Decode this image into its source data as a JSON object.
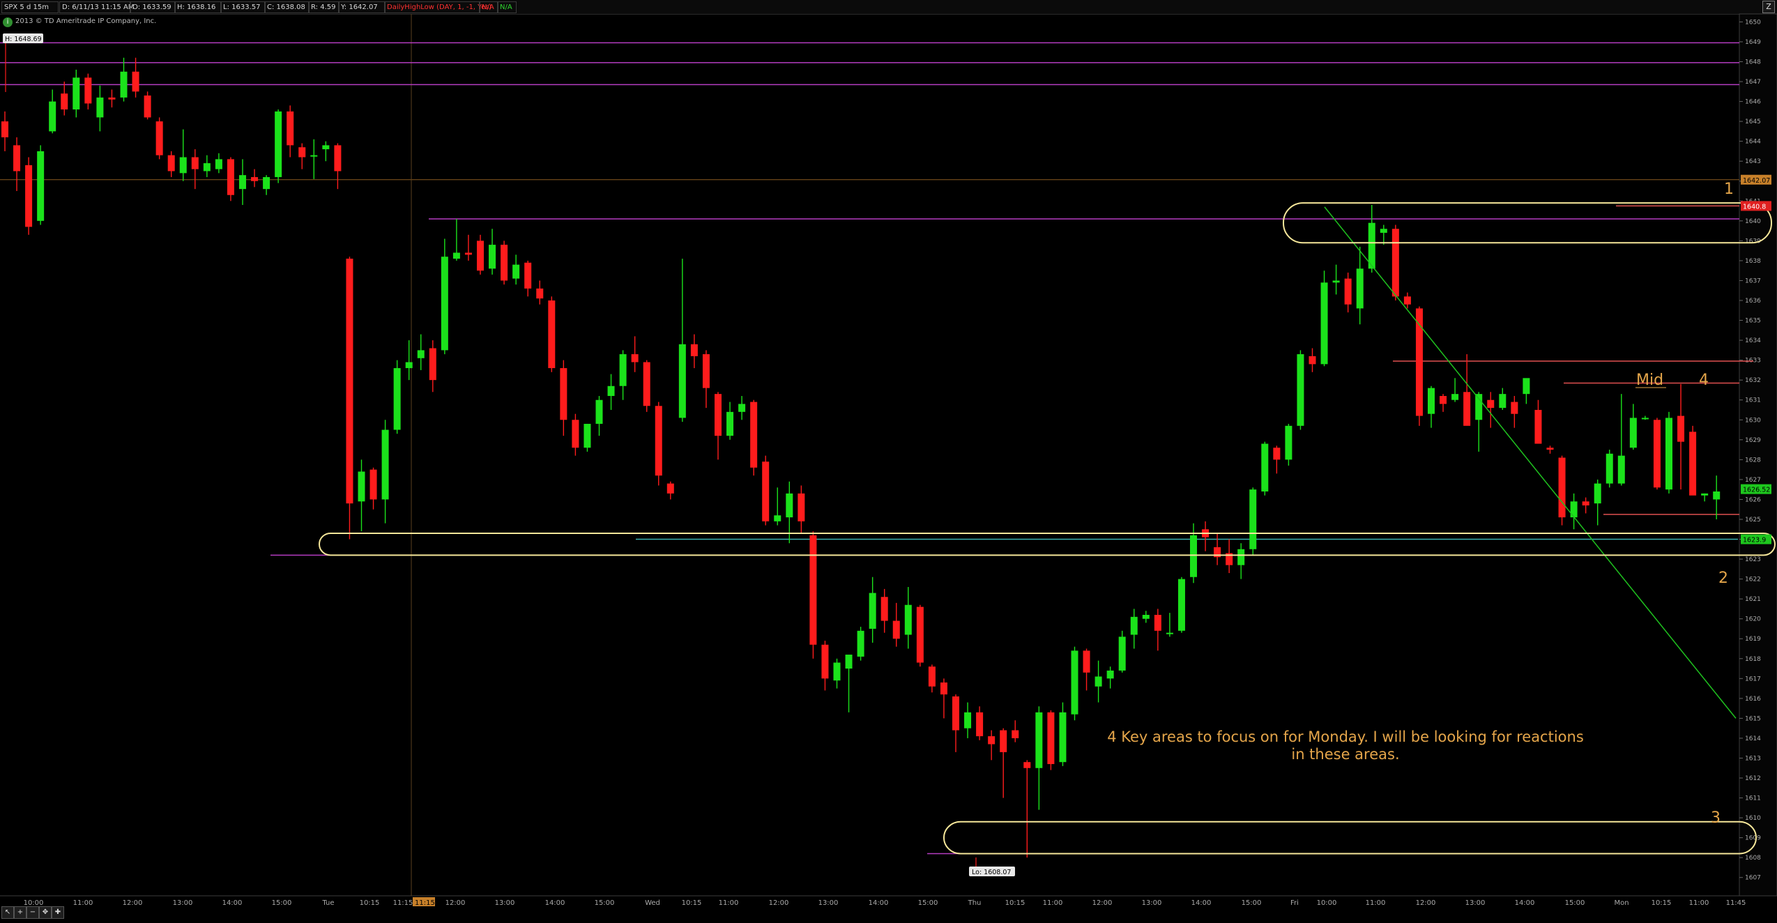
{
  "header": {
    "symbol": "SPX 5 d 15m",
    "datetime": "D: 6/11/13 11:15 AM",
    "open": "O: 1633.59",
    "high": "H: 1638.16",
    "low": "L: 1633.57",
    "close": "C: 1638.08",
    "range": "R: 4.59",
    "y": "Y: 1642.07",
    "study": "DailyHighLow (DAY, 1, -1, Yes)",
    "na1": "N/A",
    "na2": "N/A",
    "copyright": "2013 © TD Ameritrade IP Company, Inc.",
    "ib_icon": "info-i-icon",
    "corner_icon": "z-icon"
  },
  "toolbar": {
    "icons": [
      "arrow-icon",
      "zoom-in-icon",
      "zoom-out-icon",
      "pan-icon",
      "crosshair-icon"
    ]
  },
  "colors": {
    "up": "#1be21b",
    "down": "#ff1c1c",
    "annotation": "#e4a54a",
    "ellipse": "#f6e79a",
    "magenta": "#b43cc0",
    "trend": "#1fc21f",
    "resistance": "#e05050"
  },
  "chart_data": {
    "type": "candlestick",
    "ylim": [
      1606.5,
      1650.4
    ],
    "y_ticks": [
      1607,
      1608,
      1609,
      1610,
      1611,
      1612,
      1613,
      1614,
      1615,
      1616,
      1617,
      1618,
      1619,
      1620,
      1621,
      1622,
      1623,
      1624,
      1625,
      1626,
      1627,
      1628,
      1629,
      1630,
      1631,
      1632,
      1633,
      1634,
      1635,
      1636,
      1637,
      1638,
      1639,
      1640,
      1641,
      1642,
      1643,
      1644,
      1645,
      1646,
      1647,
      1648,
      1649,
      1650
    ],
    "x_ticks": [
      "10:00",
      "11:00",
      "12:00",
      "13:00",
      "14:00",
      "15:00",
      "Tue",
      "10:15",
      "11:15",
      "12:00",
      "13:00",
      "14:00",
      "15:00",
      "Wed",
      "10:15",
      "11:00",
      "12:00",
      "13:00",
      "14:00",
      "15:00",
      "Thu",
      "10:15",
      "11:00",
      "12:00",
      "13:00",
      "14:00",
      "15:00",
      "Fri",
      "10:00",
      "11:00",
      "12:00",
      "13:00",
      "14:00",
      "15:00",
      "Mon",
      "10:15",
      "11:00",
      "11:45"
    ],
    "candles": [
      [
        1645.0,
        1645.5,
        1643.5,
        1644.2
      ],
      [
        1643.8,
        1644.2,
        1641.5,
        1642.5
      ],
      [
        1642.8,
        1643.2,
        1639.3,
        1639.7
      ],
      [
        1640.0,
        1643.8,
        1639.8,
        1643.5
      ],
      [
        1644.5,
        1646.6,
        1644.4,
        1646.0
      ],
      [
        1646.4,
        1647.0,
        1645.3,
        1645.6
      ],
      [
        1645.6,
        1647.6,
        1645.2,
        1647.2
      ],
      [
        1647.2,
        1647.4,
        1645.6,
        1645.9
      ],
      [
        1645.2,
        1646.8,
        1644.5,
        1646.2
      ],
      [
        1646.2,
        1646.6,
        1645.7,
        1646.1
      ],
      [
        1646.2,
        1648.2,
        1646.0,
        1647.5
      ],
      [
        1647.5,
        1648.2,
        1646.2,
        1646.5
      ],
      [
        1646.3,
        1646.5,
        1645.1,
        1645.2
      ],
      [
        1645.0,
        1645.2,
        1643.1,
        1643.3
      ],
      [
        1643.3,
        1643.5,
        1642.2,
        1642.5
      ],
      [
        1642.4,
        1644.6,
        1642.0,
        1643.2
      ],
      [
        1643.2,
        1643.6,
        1641.6,
        1642.6
      ],
      [
        1642.5,
        1643.3,
        1642.2,
        1642.9
      ],
      [
        1642.6,
        1643.4,
        1642.4,
        1643.1
      ],
      [
        1643.1,
        1643.2,
        1641.0,
        1641.3
      ],
      [
        1641.6,
        1643.1,
        1640.8,
        1642.3
      ],
      [
        1642.2,
        1642.6,
        1641.7,
        1642.0
      ],
      [
        1641.6,
        1642.3,
        1641.3,
        1642.2
      ],
      [
        1642.2,
        1645.6,
        1641.9,
        1645.5
      ],
      [
        1645.5,
        1645.8,
        1643.2,
        1643.8
      ],
      [
        1643.7,
        1643.9,
        1642.6,
        1643.2
      ],
      [
        1643.3,
        1644.1,
        1642.1,
        1643.3
      ],
      [
        1643.6,
        1644.0,
        1643.0,
        1643.8
      ],
      [
        1643.8,
        1643.9,
        1641.6,
        1642.5
      ],
      [
        1638.1,
        1638.2,
        1624.0,
        1625.8
      ],
      [
        1625.9,
        1628.0,
        1624.4,
        1627.4
      ],
      [
        1627.5,
        1627.6,
        1625.5,
        1626.0
      ],
      [
        1626.0,
        1630.0,
        1624.8,
        1629.5
      ],
      [
        1629.5,
        1633.0,
        1629.3,
        1632.6
      ],
      [
        1632.6,
        1634.0,
        1632.0,
        1632.9
      ],
      [
        1633.1,
        1634.3,
        1632.5,
        1633.5
      ],
      [
        1633.6,
        1634.0,
        1631.4,
        1632.0
      ],
      [
        1633.5,
        1639.1,
        1633.3,
        1638.2
      ],
      [
        1638.1,
        1640.1,
        1638.0,
        1638.4
      ],
      [
        1638.4,
        1639.3,
        1638.0,
        1638.3
      ],
      [
        1639.0,
        1639.3,
        1637.3,
        1637.5
      ],
      [
        1637.6,
        1639.6,
        1637.3,
        1638.8
      ],
      [
        1638.8,
        1639.0,
        1636.8,
        1637.0
      ],
      [
        1637.1,
        1638.3,
        1636.8,
        1637.8
      ],
      [
        1637.9,
        1638.0,
        1636.2,
        1636.6
      ],
      [
        1636.6,
        1637.0,
        1635.8,
        1636.1
      ],
      [
        1636.0,
        1636.2,
        1632.4,
        1632.6
      ],
      [
        1632.6,
        1633.0,
        1629.2,
        1630.0
      ],
      [
        1630.0,
        1630.3,
        1628.2,
        1628.6
      ],
      [
        1628.6,
        1629.8,
        1628.4,
        1629.8
      ],
      [
        1629.8,
        1631.2,
        1629.2,
        1631.0
      ],
      [
        1631.2,
        1632.3,
        1630.5,
        1631.7
      ],
      [
        1631.7,
        1633.5,
        1631.0,
        1633.3
      ],
      [
        1633.3,
        1634.2,
        1632.4,
        1632.9
      ],
      [
        1632.9,
        1633.0,
        1630.4,
        1630.7
      ],
      [
        1630.7,
        1630.9,
        1626.7,
        1627.2
      ],
      [
        1626.8,
        1626.9,
        1626.0,
        1626.3
      ],
      [
        1630.1,
        1638.1,
        1629.9,
        1633.8
      ],
      [
        1633.8,
        1634.3,
        1632.6,
        1633.2
      ],
      [
        1633.3,
        1633.5,
        1630.6,
        1631.6
      ],
      [
        1631.3,
        1631.4,
        1628.0,
        1629.2
      ],
      [
        1629.2,
        1630.9,
        1629.0,
        1630.4
      ],
      [
        1630.4,
        1631.2,
        1630.0,
        1630.8
      ],
      [
        1630.9,
        1631.0,
        1627.2,
        1627.6
      ],
      [
        1627.9,
        1628.2,
        1624.7,
        1624.9
      ],
      [
        1624.9,
        1626.6,
        1624.7,
        1625.2
      ],
      [
        1625.1,
        1626.9,
        1623.8,
        1626.3
      ],
      [
        1626.3,
        1626.7,
        1624.3,
        1624.9
      ],
      [
        1624.2,
        1624.4,
        1618.0,
        1618.7
      ],
      [
        1618.7,
        1618.9,
        1616.4,
        1617.0
      ],
      [
        1616.9,
        1618.0,
        1616.5,
        1617.8
      ],
      [
        1617.5,
        1618.0,
        1615.3,
        1618.2
      ],
      [
        1618.1,
        1619.6,
        1617.9,
        1619.4
      ],
      [
        1619.5,
        1622.1,
        1618.8,
        1621.3
      ],
      [
        1621.1,
        1621.5,
        1619.3,
        1619.9
      ],
      [
        1619.9,
        1620.8,
        1618.6,
        1619.0
      ],
      [
        1619.2,
        1621.6,
        1618.5,
        1620.7
      ],
      [
        1620.6,
        1620.7,
        1617.6,
        1617.8
      ],
      [
        1617.6,
        1617.7,
        1616.3,
        1616.6
      ],
      [
        1616.8,
        1617.0,
        1615.0,
        1616.2
      ],
      [
        1616.1,
        1616.2,
        1613.3,
        1614.4
      ],
      [
        1614.5,
        1615.8,
        1614.0,
        1615.3
      ],
      [
        1615.3,
        1615.6,
        1613.9,
        1614.1
      ],
      [
        1614.1,
        1614.4,
        1612.9,
        1613.7
      ],
      [
        1614.4,
        1614.5,
        1611.0,
        1613.3
      ],
      [
        1614.4,
        1614.9,
        1613.8,
        1614.0
      ],
      [
        1612.8,
        1612.9,
        1608.0,
        1612.5
      ],
      [
        1612.5,
        1615.6,
        1610.4,
        1615.3
      ],
      [
        1615.3,
        1615.4,
        1612.4,
        1612.7
      ],
      [
        1612.8,
        1615.8,
        1612.6,
        1615.3
      ],
      [
        1615.2,
        1618.6,
        1614.9,
        1618.4
      ],
      [
        1618.4,
        1618.5,
        1616.4,
        1617.3
      ],
      [
        1616.6,
        1617.9,
        1615.8,
        1617.1
      ],
      [
        1617.0,
        1617.6,
        1616.5,
        1617.4
      ],
      [
        1617.4,
        1619.4,
        1617.3,
        1619.1
      ],
      [
        1619.2,
        1620.5,
        1618.5,
        1620.1
      ],
      [
        1620.0,
        1620.4,
        1619.8,
        1620.2
      ],
      [
        1620.2,
        1620.5,
        1618.4,
        1619.4
      ],
      [
        1619.3,
        1620.3,
        1619.1,
        1619.3
      ],
      [
        1619.4,
        1622.1,
        1619.3,
        1622.0
      ],
      [
        1622.1,
        1624.8,
        1621.8,
        1624.2
      ],
      [
        1624.5,
        1624.9,
        1623.4,
        1624.1
      ],
      [
        1623.6,
        1624.3,
        1622.7,
        1623.1
      ],
      [
        1623.3,
        1624.0,
        1622.3,
        1622.7
      ],
      [
        1622.7,
        1623.8,
        1622.0,
        1623.5
      ],
      [
        1623.5,
        1626.6,
        1623.2,
        1626.5
      ],
      [
        1626.4,
        1628.9,
        1626.2,
        1628.8
      ],
      [
        1628.6,
        1628.7,
        1627.3,
        1628.0
      ],
      [
        1628.0,
        1629.8,
        1627.7,
        1629.7
      ],
      [
        1629.7,
        1633.5,
        1629.5,
        1633.3
      ],
      [
        1633.2,
        1633.6,
        1632.4,
        1632.8
      ],
      [
        1632.8,
        1637.5,
        1632.7,
        1636.9
      ],
      [
        1636.9,
        1637.8,
        1636.3,
        1637.0
      ],
      [
        1637.1,
        1637.4,
        1635.4,
        1635.8
      ],
      [
        1635.6,
        1638.7,
        1634.8,
        1637.6
      ],
      [
        1637.6,
        1640.8,
        1637.4,
        1639.9
      ],
      [
        1639.4,
        1639.8,
        1638.8,
        1639.6
      ],
      [
        1639.6,
        1639.8,
        1636.0,
        1636.2
      ],
      [
        1636.2,
        1636.4,
        1635.6,
        1635.8
      ],
      [
        1635.6,
        1635.7,
        1629.7,
        1630.2
      ],
      [
        1630.3,
        1631.7,
        1629.6,
        1631.6
      ],
      [
        1631.2,
        1631.3,
        1630.4,
        1630.8
      ],
      [
        1631.0,
        1632.1,
        1630.9,
        1631.3
      ],
      [
        1631.4,
        1633.3,
        1630.3,
        1629.7
      ],
      [
        1630.0,
        1631.4,
        1628.4,
        1631.3
      ],
      [
        1631.0,
        1631.4,
        1629.6,
        1630.6
      ],
      [
        1630.6,
        1631.6,
        1630.5,
        1631.3
      ],
      [
        1630.9,
        1631.2,
        1629.6,
        1630.3
      ],
      [
        1631.3,
        1631.9,
        1630.8,
        1632.1
      ],
      [
        1630.5,
        1631.0,
        1628.8,
        1628.8
      ],
      [
        1628.6,
        1628.7,
        1628.3,
        1628.5
      ],
      [
        1628.1,
        1628.2,
        1624.7,
        1625.1
      ],
      [
        1625.1,
        1626.3,
        1624.5,
        1625.9
      ],
      [
        1625.9,
        1626.1,
        1625.3,
        1625.7
      ],
      [
        1625.8,
        1627.0,
        1624.7,
        1626.8
      ],
      [
        1626.8,
        1628.5,
        1626.6,
        1628.3
      ],
      [
        1626.8,
        1631.3,
        1626.7,
        1628.2
      ],
      [
        1628.6,
        1630.8,
        1628.5,
        1630.1
      ],
      [
        1630.1,
        1630.2,
        1630.0,
        1630.1
      ],
      [
        1630.0,
        1630.1,
        1626.5,
        1626.6
      ],
      [
        1626.5,
        1630.4,
        1626.3,
        1630.1
      ],
      [
        1630.2,
        1631.8,
        1626.5,
        1628.9
      ],
      [
        1629.4,
        1629.7,
        1628.2,
        1626.2
      ],
      [
        1626.2,
        1626.3,
        1625.9,
        1626.3
      ],
      [
        1626.0,
        1627.2,
        1625.0,
        1626.4
      ]
    ],
    "price_labels": {
      "last": "1626.52",
      "prev_close": "1642.07",
      "daily_high": "1640.8",
      "bid_ask": "1623.9",
      "session_high": "H: 1648.69",
      "session_low": "Lo: 1608.07"
    },
    "key_level_numbers": [
      "1",
      "2",
      "3",
      "4"
    ],
    "mid_label": "Mid",
    "note": "4 Key areas to focus on for Monday. I will be looking for reactions in these areas."
  }
}
